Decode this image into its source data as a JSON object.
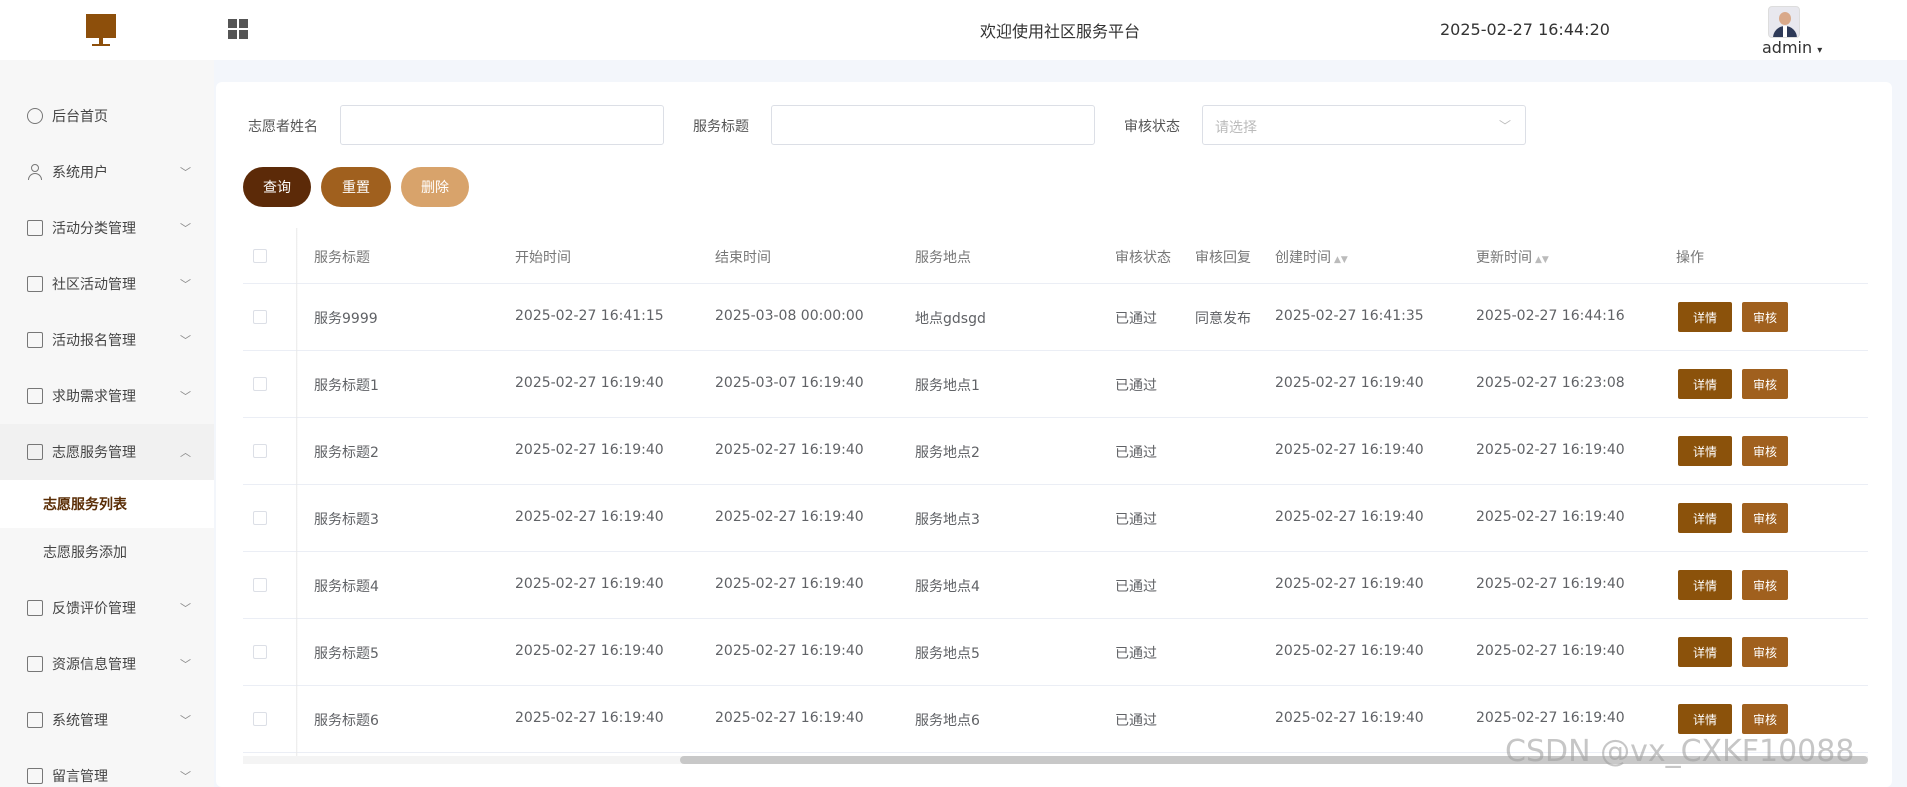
{
  "header": {
    "title": "欢迎使用社区服务平台",
    "datetime": "2025-02-27 16:44:20",
    "username": "admin"
  },
  "sidebar": {
    "items": [
      {
        "label": "后台首页"
      },
      {
        "label": "系统用户"
      },
      {
        "label": "活动分类管理"
      },
      {
        "label": "社区活动管理"
      },
      {
        "label": "活动报名管理"
      },
      {
        "label": "求助需求管理"
      },
      {
        "label": "志愿服务管理"
      },
      {
        "label": "反馈评价管理"
      },
      {
        "label": "资源信息管理"
      },
      {
        "label": "系统管理"
      },
      {
        "label": "留言管理"
      }
    ],
    "subitems": [
      {
        "label": "志愿服务列表"
      },
      {
        "label": "志愿服务添加"
      }
    ]
  },
  "filters": {
    "volunteer_name_label": "志愿者姓名",
    "service_title_label": "服务标题",
    "review_status_label": "审核状态",
    "review_status_placeholder": "请选择"
  },
  "buttons": {
    "query": "查询",
    "reset": "重置",
    "delete": "删除"
  },
  "colors": {
    "query_btn": "#5c2a08",
    "reset_btn": "#a0601e",
    "delete_btn": "#d8a36b",
    "detail_btn": "#8b520b",
    "review_btn": "#a0601e"
  },
  "table": {
    "headers": {
      "title": "服务标题",
      "start": "开始时间",
      "end": "结束时间",
      "location": "服务地点",
      "status": "审核状态",
      "reply": "审核回复",
      "created": "创建时间",
      "updated": "更新时间",
      "actions": "操作"
    },
    "detail_label": "详情",
    "review_label": "审核",
    "rows": [
      {
        "title": "服务9999",
        "start": "2025-02-27 16:41:15",
        "end": "2025-03-08 00:00:00",
        "location": "地点gdsgd",
        "status": "已通过",
        "reply": "同意发布",
        "created": "2025-02-27 16:41:35",
        "updated": "2025-02-27 16:44:16"
      },
      {
        "title": "服务标题1",
        "start": "2025-02-27 16:19:40",
        "end": "2025-03-07 16:19:40",
        "location": "服务地点1",
        "status": "已通过",
        "reply": "",
        "created": "2025-02-27 16:19:40",
        "updated": "2025-02-27 16:23:08"
      },
      {
        "title": "服务标题2",
        "start": "2025-02-27 16:19:40",
        "end": "2025-02-27 16:19:40",
        "location": "服务地点2",
        "status": "已通过",
        "reply": "",
        "created": "2025-02-27 16:19:40",
        "updated": "2025-02-27 16:19:40"
      },
      {
        "title": "服务标题3",
        "start": "2025-02-27 16:19:40",
        "end": "2025-02-27 16:19:40",
        "location": "服务地点3",
        "status": "已通过",
        "reply": "",
        "created": "2025-02-27 16:19:40",
        "updated": "2025-02-27 16:19:40"
      },
      {
        "title": "服务标题4",
        "start": "2025-02-27 16:19:40",
        "end": "2025-02-27 16:19:40",
        "location": "服务地点4",
        "status": "已通过",
        "reply": "",
        "created": "2025-02-27 16:19:40",
        "updated": "2025-02-27 16:19:40"
      },
      {
        "title": "服务标题5",
        "start": "2025-02-27 16:19:40",
        "end": "2025-02-27 16:19:40",
        "location": "服务地点5",
        "status": "已通过",
        "reply": "",
        "created": "2025-02-27 16:19:40",
        "updated": "2025-02-27 16:19:40"
      },
      {
        "title": "服务标题6",
        "start": "2025-02-27 16:19:40",
        "end": "2025-02-27 16:19:40",
        "location": "服务地点6",
        "status": "已通过",
        "reply": "",
        "created": "2025-02-27 16:19:40",
        "updated": "2025-02-27 16:19:40"
      }
    ]
  },
  "watermark": "CSDN @vx_CXKF10088"
}
